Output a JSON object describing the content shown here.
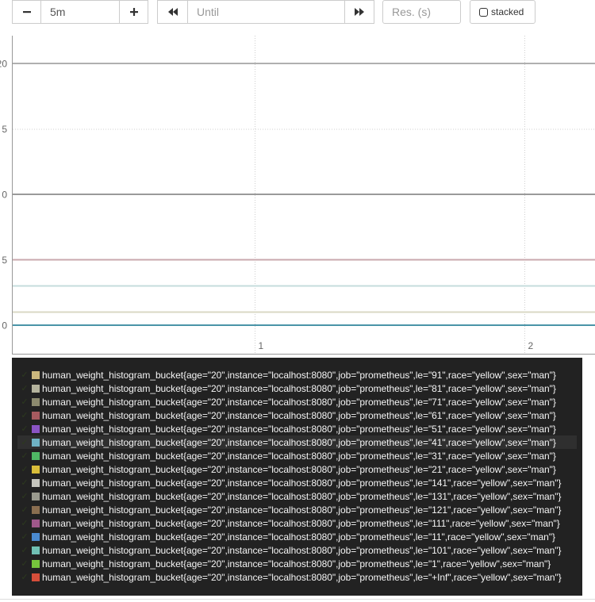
{
  "toolbar": {
    "range_value": "5m",
    "until_placeholder": "Until",
    "resolution_placeholder": "Res. (s)",
    "stacked_label": "stacked"
  },
  "graph": {
    "y_ticks": [
      {
        "label": "20",
        "value": 20
      },
      {
        "label": "5",
        "value": 15
      },
      {
        "label": "0",
        "value": 10
      },
      {
        "label": "5",
        "value": 5
      },
      {
        "label": "0",
        "value": 0
      }
    ],
    "x_ticks": [
      {
        "label": "1"
      },
      {
        "label": "2"
      }
    ]
  },
  "legend": {
    "items": [
      {
        "label": "human_weight_histogram_bucket{age=\"20\",instance=\"localhost:8080\",job=\"prometheus\",le=\"91\",race=\"yellow\",sex=\"man\"}",
        "color": "#cbb77d"
      },
      {
        "label": "human_weight_histogram_bucket{age=\"20\",instance=\"localhost:8080\",job=\"prometheus\",le=\"81\",race=\"yellow\",sex=\"man\"}",
        "color": "#b4b39d"
      },
      {
        "label": "human_weight_histogram_bucket{age=\"20\",instance=\"localhost:8080\",job=\"prometheus\",le=\"71\",race=\"yellow\",sex=\"man\"}",
        "color": "#8c8a6e"
      },
      {
        "label": "human_weight_histogram_bucket{age=\"20\",instance=\"localhost:8080\",job=\"prometheus\",le=\"61\",race=\"yellow\",sex=\"man\"}",
        "color": "#a65a5f"
      },
      {
        "label": "human_weight_histogram_bucket{age=\"20\",instance=\"localhost:8080\",job=\"prometheus\",le=\"51\",race=\"yellow\",sex=\"man\"}",
        "color": "#8a54c4"
      },
      {
        "label": "human_weight_histogram_bucket{age=\"20\",instance=\"localhost:8080\",job=\"prometheus\",le=\"41\",race=\"yellow\",sex=\"man\"}",
        "color": "#6fb2c4"
      },
      {
        "label": "human_weight_histogram_bucket{age=\"20\",instance=\"localhost:8080\",job=\"prometheus\",le=\"31\",race=\"yellow\",sex=\"man\"}",
        "color": "#4fb865"
      },
      {
        "label": "human_weight_histogram_bucket{age=\"20\",instance=\"localhost:8080\",job=\"prometheus\",le=\"21\",race=\"yellow\",sex=\"man\"}",
        "color": "#d9be3a"
      },
      {
        "label": "human_weight_histogram_bucket{age=\"20\",instance=\"localhost:8080\",job=\"prometheus\",le=\"141\",race=\"yellow\",sex=\"man\"}",
        "color": "#c6c6be"
      },
      {
        "label": "human_weight_histogram_bucket{age=\"20\",instance=\"localhost:8080\",job=\"prometheus\",le=\"131\",race=\"yellow\",sex=\"man\"}",
        "color": "#9a9a8e"
      },
      {
        "label": "human_weight_histogram_bucket{age=\"20\",instance=\"localhost:8080\",job=\"prometheus\",le=\"121\",race=\"yellow\",sex=\"man\"}",
        "color": "#8a6e50"
      },
      {
        "label": "human_weight_histogram_bucket{age=\"20\",instance=\"localhost:8080\",job=\"prometheus\",le=\"111\",race=\"yellow\",sex=\"man\"}",
        "color": "#a0588a"
      },
      {
        "label": "human_weight_histogram_bucket{age=\"20\",instance=\"localhost:8080\",job=\"prometheus\",le=\"11\",race=\"yellow\",sex=\"man\"}",
        "color": "#4a8ad0"
      },
      {
        "label": "human_weight_histogram_bucket{age=\"20\",instance=\"localhost:8080\",job=\"prometheus\",le=\"101\",race=\"yellow\",sex=\"man\"}",
        "color": "#70c0b4"
      },
      {
        "label": "human_weight_histogram_bucket{age=\"20\",instance=\"localhost:8080\",job=\"prometheus\",le=\"1\",race=\"yellow\",sex=\"man\"}",
        "color": "#76c43c"
      },
      {
        "label": "human_weight_histogram_bucket{age=\"20\",instance=\"localhost:8080\",job=\"prometheus\",le=\"+Inf\",race=\"yellow\",sex=\"man\"}",
        "color": "#d64e3a"
      }
    ]
  },
  "lines": [
    {
      "value": 20,
      "color": "#b0b0b0"
    },
    {
      "value": 10,
      "color": "#9a9a9a"
    },
    {
      "value": 5,
      "color": "#c9a8ae"
    },
    {
      "value": 3,
      "color": "#c5dcdc"
    },
    {
      "value": 1,
      "color": "#d9d8c4"
    },
    {
      "value": 0,
      "color": "#4a94a8"
    }
  ]
}
